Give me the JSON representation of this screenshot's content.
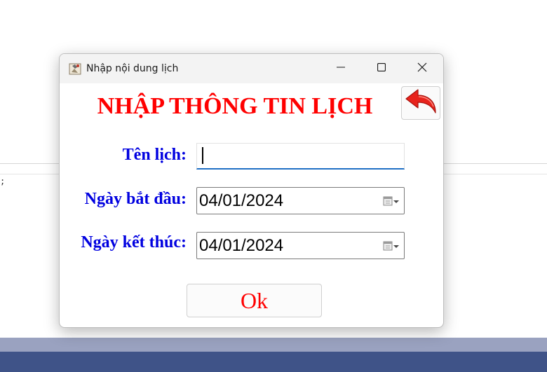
{
  "background": {
    "code_fragment": ";"
  },
  "window": {
    "title": "Nhập nội dung lịch",
    "controls": {
      "minimize_icon": "minimize-icon",
      "maximize_icon": "maximize-icon",
      "close_icon": "close-icon"
    }
  },
  "form": {
    "heading": "NHẬP THÔNG TIN LỊCH",
    "back_icon": "back-arrow-icon",
    "name_label": "Tên lịch:",
    "name_value": "",
    "start_label": "Ngày bắt đầu:",
    "start_value": "04/01/2024",
    "end_label": "Ngày kết thúc:",
    "end_value": "04/01/2024",
    "date_picker_icon": "calendar-dropdown-icon",
    "ok_label": "Ok"
  },
  "colors": {
    "heading": "#ff0000",
    "label": "#0000e0",
    "ok_text": "#ff0000",
    "input_focus": "#1f6fc5",
    "taskbar": "#3f5388"
  }
}
